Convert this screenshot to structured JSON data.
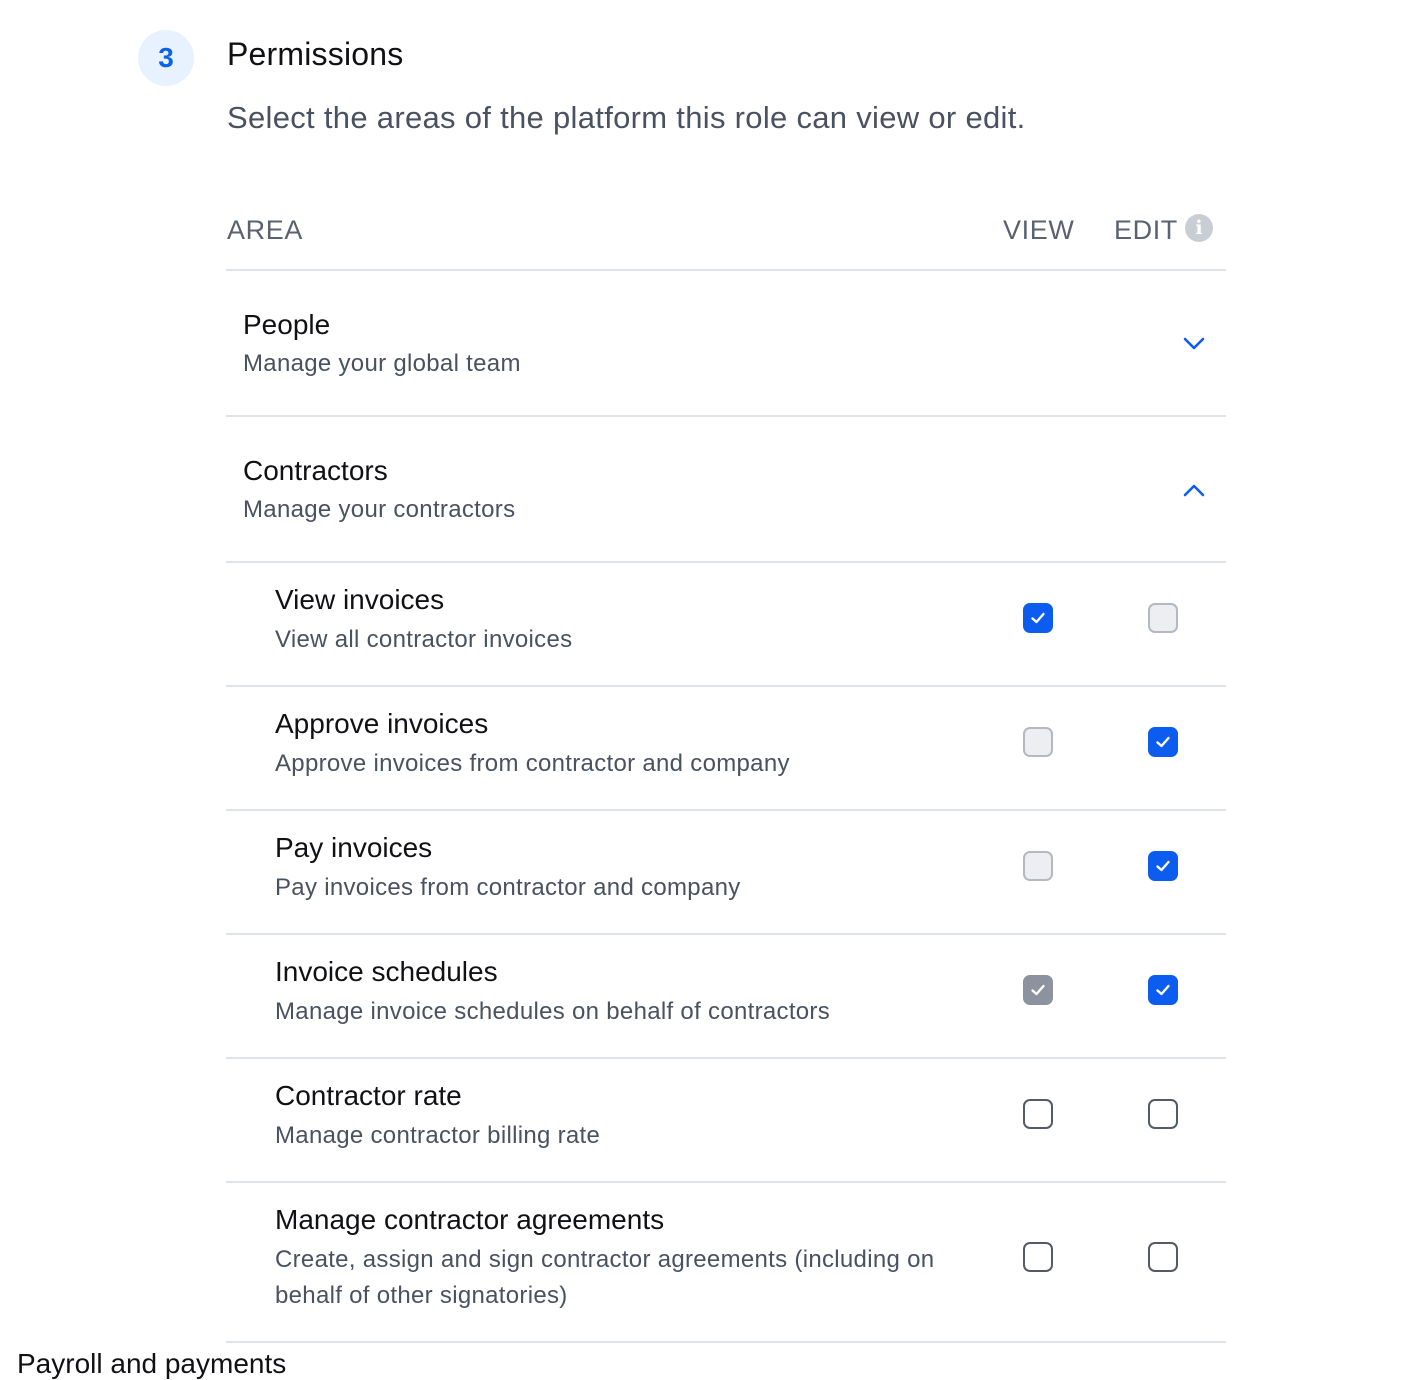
{
  "step": {
    "number": "3",
    "title": "Permissions",
    "description": "Select the areas of the platform this role can view or edit."
  },
  "table": {
    "headers": {
      "area": "AREA",
      "view": "VIEW",
      "edit": "EDIT"
    },
    "info_icon_glyph": "i"
  },
  "groups": [
    {
      "title": "People",
      "subtitle": "Manage your global team",
      "expanded": false
    },
    {
      "title": "Contractors",
      "subtitle": "Manage your contractors",
      "expanded": true
    }
  ],
  "contractor_permissions": [
    {
      "title": "View invoices",
      "subtitle": "View all contractor invoices",
      "view": "checked",
      "edit": "unchecked-disabled"
    },
    {
      "title": "Approve invoices",
      "subtitle": "Approve invoices from contractor and company",
      "view": "unchecked-disabled",
      "edit": "checked"
    },
    {
      "title": "Pay invoices",
      "subtitle": "Pay invoices from contractor and company",
      "view": "unchecked-disabled",
      "edit": "checked"
    },
    {
      "title": "Invoice schedules",
      "subtitle": "Manage invoice schedules on behalf of contractors",
      "view": "checked-disabled",
      "edit": "checked"
    },
    {
      "title": "Contractor rate",
      "subtitle": "Manage contractor billing rate",
      "view": "unchecked",
      "edit": "unchecked"
    },
    {
      "title": "Manage contractor agreements",
      "subtitle": "Create, assign and sign contractor agreements (including on behalf of other signatories)",
      "view": "unchecked",
      "edit": "unchecked"
    }
  ],
  "next_group": {
    "title": "Payroll and payments"
  },
  "colors": {
    "accent": "#0d5cf0",
    "badge_bg": "#e8f1fe",
    "divider": "#dfe2e7",
    "disabled_checked": "#8d939e"
  },
  "icons": {
    "checkmark": "check-icon",
    "collapsed": "chevron-down-icon",
    "expanded": "chevron-up-icon",
    "info": "info-icon"
  }
}
